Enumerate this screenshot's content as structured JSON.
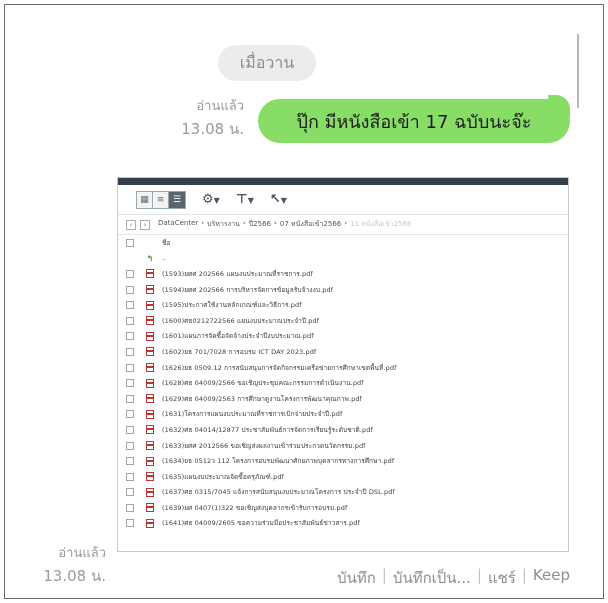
{
  "date_chip": "เมื่อวาน",
  "message1": {
    "read_label": "อ่านแล้ว",
    "time": "13.08 น.",
    "text": "ปุ๊ก มีหนังสือเข้า 17 ฉบับนะจ๊ะ"
  },
  "message2": {
    "read_label": "อ่านแล้ว",
    "time": "13.08 น."
  },
  "file_manager": {
    "breadcrumbs": [
      "DataCenter",
      "บริหารงาน",
      "ปี2566",
      "07 หนังสือเข้า2566",
      "11 หนังสือเข้า2566"
    ],
    "header_label": "ชื่อ",
    "up_label": "..",
    "files": [
      "(1593)ยศศ 202566 แผนงบประมาณที่ราชการ.pdf",
      "(1594)ยศศ 202566 การบริหารจัดการข้อมูลรับจ้างงบ.pdf",
      "(1595)ประกาศใช้งานหลักเกณฑ์และวิธีการ.pdf",
      "(1600)ศธ0212722566 แผนงบประมาณประจำปี.pdf",
      "(1601)แผนการจัดซื้อจัดจ้างประจำปีงบประมาณ.pdf",
      "(1602)ยธ 701/7028 การอบรม ICT DAY 2023.pdf",
      "(1626)ยธ 0509.12 การสนับสนุนการจัดกิจกรรมเครือข่ายการศึกษาเขตพื้นที่.pdf",
      "(1628)ศธ 04009/2566 ขอเชิญประชุมคณะกรรมการดำเนินงาน.pdf",
      "(1629)ศธ 04009/2563 การศึกษาดูงานโครงการพัฒนาคุณภาพ.pdf",
      "(1631)โครงการแผนงบประมาณที่ราชการเบิกจ่ายประจำปี.pdf",
      "(1632)ศธ 04014/12877 ประชาสัมพันธ์การจัดการเรียนรู้ระดับชาติ.pdf",
      "(1633)ยศศ 2012566 ขอเชิญส่งผลงานเข้าร่วมประกวดนวัตกรรม.pdf",
      "(1634)ยธ 0512ว 112 โครงการอบรมพัฒนาศักยภาพบุคลากรทางการศึกษา.pdf",
      "(1635)แผนงบประมาณจัดซื้อครุภัณฑ์.pdf",
      "(1637)ศธ 0315/7045 แจ้งการสนับสนุนงบประมาณโครงการ ประจำปี DSL.pdf",
      "(1639)ยศ 0407(1)322 ขอเชิญส่งบุคลากรเข้ารับการอบรม.pdf",
      "(1641)ศธ 04009/2605 ขอความร่วมมือประชาสัมพันธ์ข่าวสาร.pdf"
    ]
  },
  "actions": {
    "save": "บันทึก",
    "save_as": "บันทึกเป็น...",
    "share": "แชร์",
    "keep": "Keep"
  }
}
